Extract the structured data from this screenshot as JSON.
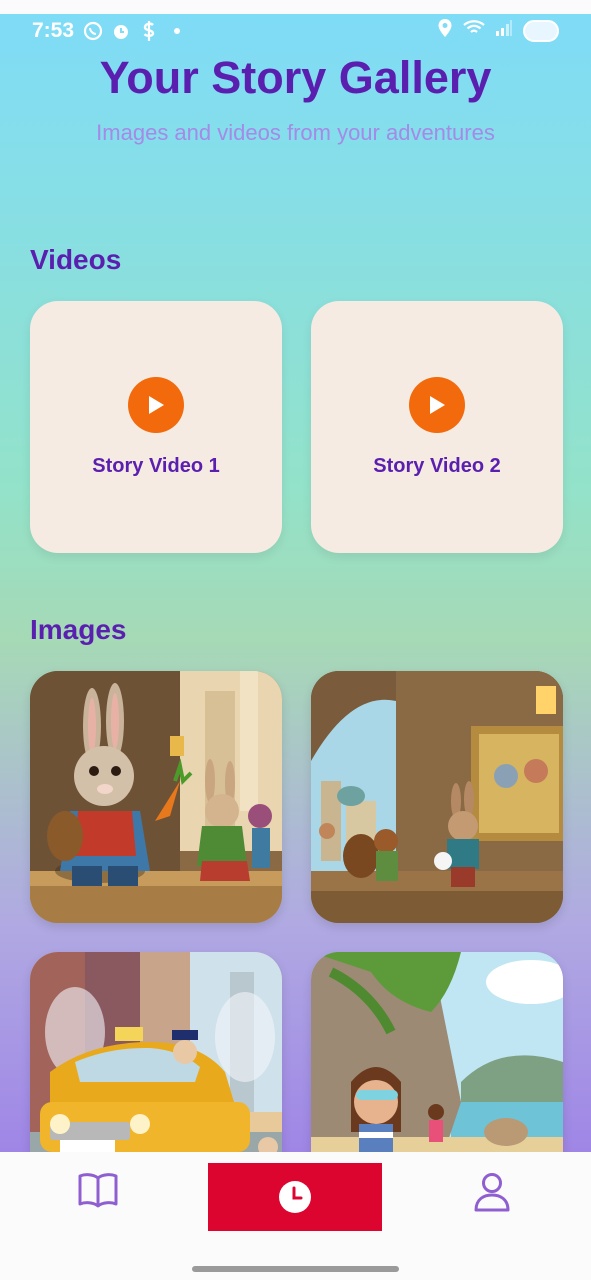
{
  "status_bar": {
    "time": "7:53",
    "icons": [
      "whatsapp-icon",
      "alarm-icon",
      "dollar-icon",
      "dot-icon"
    ],
    "right_icons": [
      "location-icon",
      "wifi-icon",
      "signal-icon",
      "battery-icon"
    ]
  },
  "header": {
    "title": "Your Story Gallery",
    "subtitle": "Images and videos from your adventures"
  },
  "videos": {
    "section_title": "Videos",
    "items": [
      {
        "label": "Story Video 1"
      },
      {
        "label": "Story Video 2"
      }
    ]
  },
  "images": {
    "section_title": "Images",
    "items": [
      "bunny-market-image",
      "squirrel-tapestry-image",
      "taxi-fairy-image",
      "beach-girl-image"
    ]
  },
  "bottom_nav": {
    "items": [
      "book-icon",
      "clock-icon",
      "user-icon"
    ],
    "active_index": 1
  },
  "colors": {
    "accent": "#5b1fb0",
    "subtitle": "#a58ae6",
    "play": "#f26a0b",
    "card_bg": "#f5ebe2",
    "nav_active": "#dc0530"
  }
}
